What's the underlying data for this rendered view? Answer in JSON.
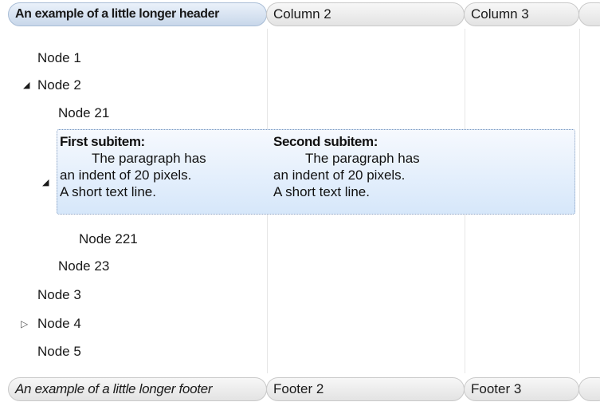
{
  "header": {
    "columns": [
      "An example of a little longer header",
      "Column 2",
      "Column 3",
      ""
    ]
  },
  "tree": {
    "nodes": [
      {
        "label": "Node 1"
      },
      {
        "label": "Node 2",
        "expander": "expanded"
      },
      {
        "label": "Node 21"
      },
      {
        "label": "Node 221"
      },
      {
        "label": "Node 23"
      },
      {
        "label": "Node 3"
      },
      {
        "label": "Node 4",
        "expander": "collapsed"
      },
      {
        "label": "Node 5"
      }
    ],
    "selected_row": {
      "expander": "expanded",
      "subitems": [
        {
          "title": "First subitem:",
          "line1": "The paragraph has",
          "line2": "an indent of 20 pixels.",
          "line3": "A short text line."
        },
        {
          "title": "Second subitem:",
          "line1": "The paragraph has",
          "line2": "an indent of 20 pixels.",
          "line3": "A short text line."
        }
      ]
    }
  },
  "footer": {
    "columns": [
      "An example of a little longer footer",
      "Footer 2",
      "Footer 3",
      ""
    ]
  },
  "icons": {
    "expanded": "triangle-expanded-icon",
    "collapsed": "triangle-collapsed-icon"
  },
  "colors": {
    "selection_border": "#7d98bd",
    "selection_fill": "#d6e7fa",
    "header_highlight": "#c8d7ea"
  }
}
